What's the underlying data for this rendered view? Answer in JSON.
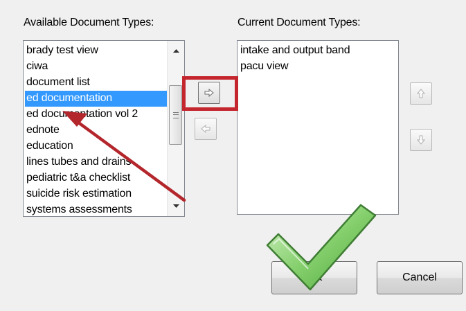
{
  "available": {
    "label": "Available Document Types:",
    "items": [
      "brady test view",
      "ciwa",
      "document list",
      "ed documentation",
      "ed documentation vol 2",
      "ednote",
      "education",
      "lines tubes and drains",
      "pediatric t&a checklist",
      "suicide risk estimation",
      "systems assessments"
    ],
    "selected_item": "ed documentation"
  },
  "current": {
    "label": "Current Document Types:",
    "items": [
      "intake and output band",
      "pacu view"
    ]
  },
  "buttons": {
    "ok": "OK",
    "cancel": "Cancel"
  },
  "icons": {
    "add": "arrow-right-icon",
    "remove": "arrow-left-icon",
    "move_up": "arrow-up-icon",
    "move_down": "arrow-down-icon",
    "scroll_up": "scroll-up-arrow-icon",
    "scroll_down": "scroll-down-arrow-icon",
    "pointer_arrow": "red-pointer-arrow",
    "checkmark": "green-checkmark"
  },
  "colors": {
    "selection": "#3399ff",
    "highlight": "#c4262e",
    "pointer_arrow": "#b3262c",
    "checkmark": "#7fcf6a"
  }
}
